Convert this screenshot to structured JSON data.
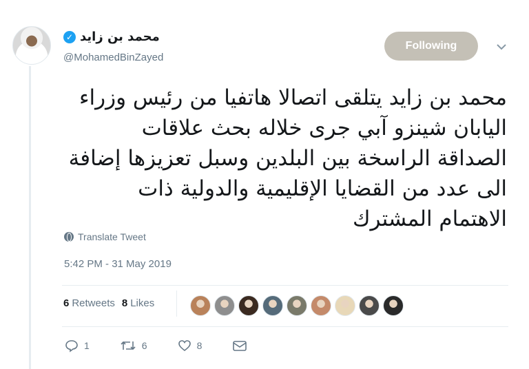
{
  "author": {
    "display_name": "محمد بن زايد",
    "handle": "@MohamedBinZayed",
    "verified": true
  },
  "follow_button": {
    "label": "Following"
  },
  "tweet": {
    "text": "محمد بن زايد يتلقى اتصالا هاتفيا من رئيس وزراء اليابان شينزو آبي جرى خلاله بحث علاقات الصداقة الراسخة بين البلدين وسبل تعزيزها إضافة الى عدد من القضايا الإقليمية والدولية ذات الاهتمام المشترك",
    "translate_label": "Translate Tweet",
    "timestamp": "5:42 PM - 31 May 2019"
  },
  "stats": {
    "retweets_count": "6",
    "retweets_label": "Retweets",
    "likes_count": "8",
    "likes_label": "Likes"
  },
  "likers": [
    {
      "color": "#b9825a"
    },
    {
      "color": "#8e8e8e"
    },
    {
      "color": "#3b2a20"
    },
    {
      "color": "#556b7a"
    },
    {
      "color": "#7a7a6a"
    },
    {
      "color": "#c48a6a"
    },
    {
      "color": "#e8d8b8"
    },
    {
      "color": "#4a4a4a"
    },
    {
      "color": "#2a2a2a"
    }
  ],
  "actions": {
    "reply_count": "1",
    "retweet_count": "6",
    "like_count": "8"
  },
  "colors": {
    "accent": "#1da1f2",
    "following_button_bg": "#c4c0b6",
    "muted_text": "#657786"
  },
  "icons": {
    "verified": "verified-badge-icon",
    "caret": "chevron-down-icon",
    "translate": "globe-icon",
    "reply": "reply-icon",
    "retweet": "retweet-icon",
    "like": "heart-icon",
    "message": "envelope-icon"
  }
}
